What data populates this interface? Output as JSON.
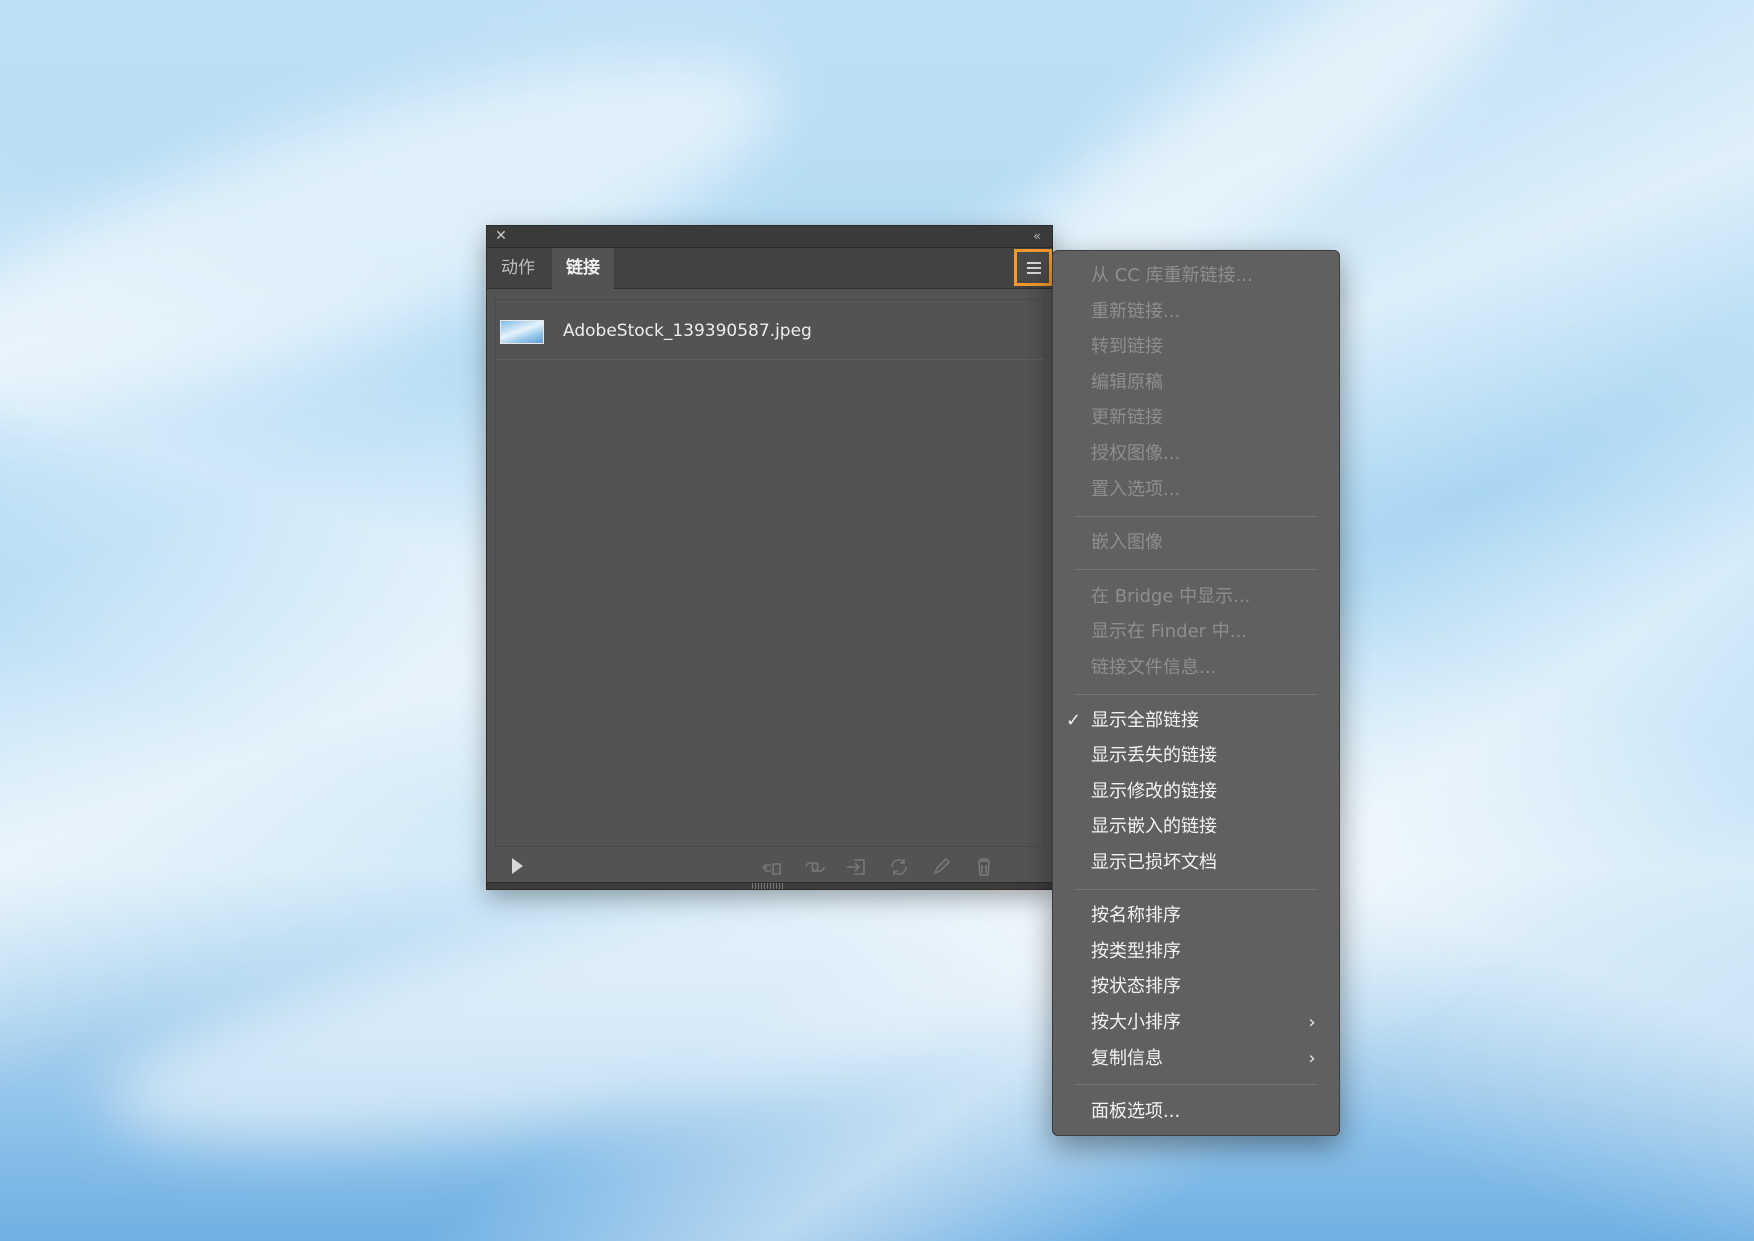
{
  "panel": {
    "tabs": [
      {
        "label": "动作",
        "active": false
      },
      {
        "label": "链接",
        "active": true
      }
    ],
    "links": [
      {
        "name": "AdobeStock_139390587.jpeg"
      }
    ],
    "toolbar_icons": [
      "relink-from-cc-icon",
      "relink-icon",
      "go-to-link-icon",
      "update-link-icon",
      "edit-original-icon",
      "delete-icon"
    ]
  },
  "menu": {
    "group1": [
      "从 CC 库重新链接...",
      "重新链接...",
      "转到链接",
      "编辑原稿",
      "更新链接",
      "授权图像...",
      "置入选项..."
    ],
    "group2": [
      "嵌入图像"
    ],
    "group3": [
      "在 Bridge 中显示...",
      "显示在 Finder 中...",
      "链接文件信息..."
    ],
    "group4": [
      "显示全部链接",
      "显示丢失的链接",
      "显示修改的链接",
      "显示嵌入的链接",
      "显示已损坏文档"
    ],
    "group5": [
      "按名称排序",
      "按类型排序",
      "按状态排序",
      "按大小排序",
      "复制信息"
    ],
    "group6": [
      "面板选项..."
    ],
    "checked_item": "显示全部链接"
  },
  "colors": {
    "highlight": "#f29a2e",
    "panel_bg": "#535353",
    "menu_bg": "#606060"
  }
}
